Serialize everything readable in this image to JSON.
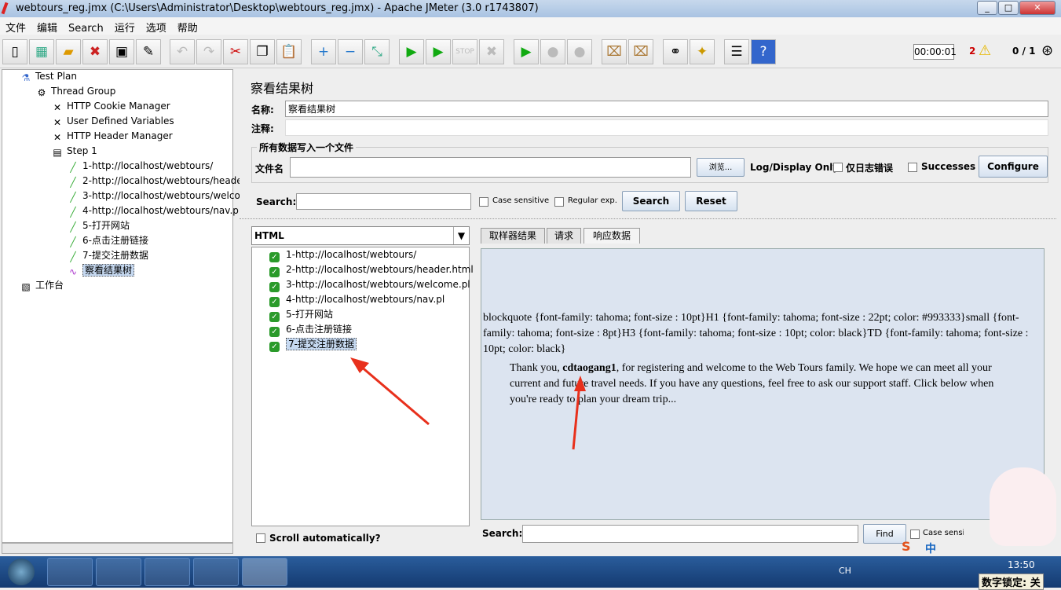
{
  "window": {
    "title": "webtours_reg.jmx (C:\\Users\\Administrator\\Desktop\\webtours_reg.jmx) - Apache JMeter (3.0 r1743807)"
  },
  "menu": [
    "文件",
    "编辑",
    "Search",
    "运行",
    "选项",
    "帮助"
  ],
  "toolbar": {
    "timer": "00:00:01",
    "warnings": "2",
    "threads": "0 / 1",
    "stop_label": "STOP"
  },
  "tree": [
    {
      "label": "Test Plan",
      "icon": "flask-icon"
    },
    {
      "label": "Thread Group",
      "icon": "gear-icon"
    },
    {
      "label": "HTTP Cookie Manager",
      "icon": "wrench-icon"
    },
    {
      "label": "User Defined Variables",
      "icon": "wrench-icon"
    },
    {
      "label": "HTTP Header Manager",
      "icon": "wrench-icon"
    },
    {
      "label": "Step 1",
      "icon": "controller-icon"
    },
    {
      "label": "1-http://localhost/webtours/",
      "icon": "pipette-icon"
    },
    {
      "label": "2-http://localhost/webtours/header.html",
      "icon": "pipette-icon"
    },
    {
      "label": "3-http://localhost/webtours/welcome.pl",
      "icon": "pipette-icon"
    },
    {
      "label": "4-http://localhost/webtours/nav.pl",
      "icon": "pipette-icon"
    },
    {
      "label": "5-打开网站",
      "icon": "pipette-icon"
    },
    {
      "label": "6-点击注册链接",
      "icon": "pipette-icon"
    },
    {
      "label": "7-提交注册数据",
      "icon": "pipette-icon"
    },
    {
      "label": "察看结果树",
      "icon": "chart-icon"
    },
    {
      "label": "工作台",
      "icon": "workbench-icon"
    }
  ],
  "panel": {
    "title": "察看结果树",
    "name_label": "名称:",
    "name_value": "察看结果树",
    "comment_label": "注释:",
    "comment_value": "",
    "file_group": "所有数据写入一个文件",
    "file_label": "文件名",
    "file_value": "",
    "browse": "浏览...",
    "log_display": "Log/Display Only:",
    "errors_only": "仅日志错误",
    "successes": "Successes",
    "configure": "Configure"
  },
  "search": {
    "label": "Search:",
    "value": "",
    "case_sensitive": "Case sensitive",
    "regex": "Regular exp.",
    "search_btn": "Search",
    "reset_btn": "Reset"
  },
  "renderer": "HTML",
  "results": [
    "1-http://localhost/webtours/",
    "2-http://localhost/webtours/header.html",
    "3-http://localhost/webtours/welcome.pl",
    "4-http://localhost/webtours/nav.pl",
    "5-打开网站",
    "6-点击注册链接",
    "7-提交注册数据"
  ],
  "scroll_auto": "Scroll automatically?",
  "tabs": [
    "取样器结果",
    "请求",
    "响应数据"
  ],
  "response": {
    "css": "blockquote {font-family: tahoma; font-size : 10pt}H1 {font-family: tahoma; font-size : 22pt; color: #993333}small {font-family: tahoma; font-size : 8pt}H3 {font-family: tahoma; font-size : 10pt; color: black}TD {font-family: tahoma; font-size : 10pt; color: black}",
    "pre": "Thank you, ",
    "user": "cdtaogang1",
    "post": ", for registering and welcome to the Web Tours family. We hope we can meet all your current and future travel needs. If you have any questions, feel free to ask our support staff. Click below when you're ready to plan your dream trip..."
  },
  "bottom_search": {
    "label": "Search:",
    "value": "",
    "find": "Find",
    "case_sensitive": "Case sensiti"
  },
  "taskbar": {
    "lang": "CH",
    "clock": "13:50",
    "numlock": "数字锁定: 关",
    "ime": "中"
  },
  "colors": {
    "annotation_arrow": "#e8301c",
    "success": "#2a9a2a"
  }
}
